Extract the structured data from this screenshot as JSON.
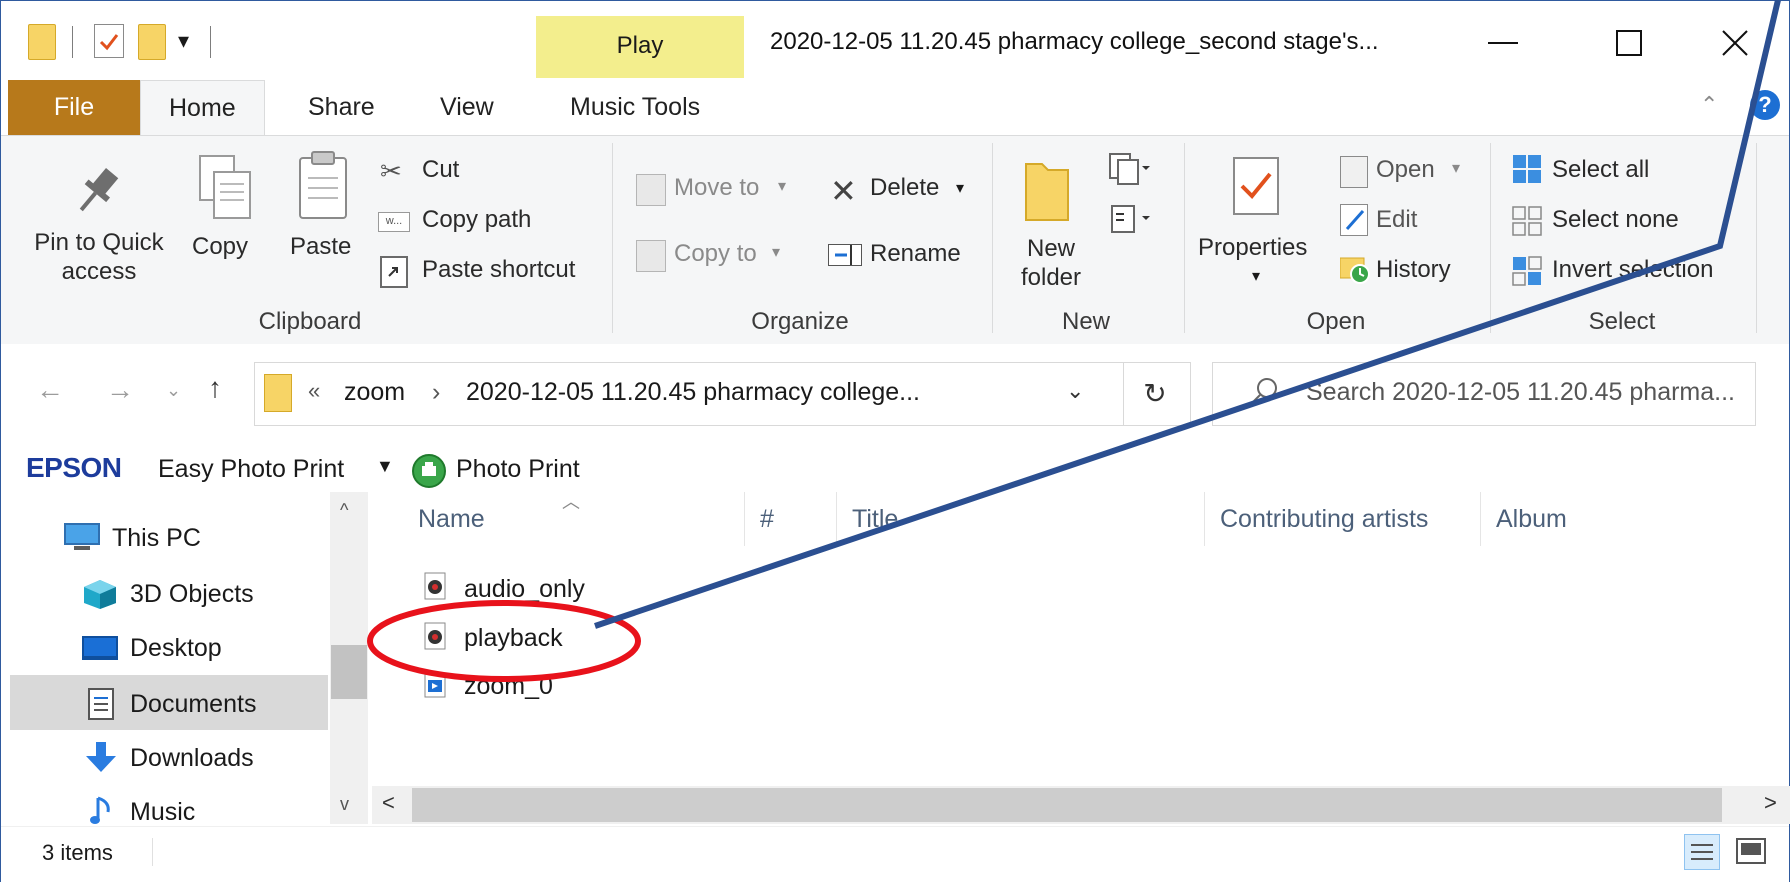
{
  "window": {
    "title": "2020-12-05 11.20.45 pharmacy college_second stage's...",
    "contextual_tab": "Play",
    "minimize_icon": "minimize-icon",
    "maximize_icon": "maximize-icon",
    "close_icon": "close-icon"
  },
  "ribbon_tabs": [
    "File",
    "Home",
    "Share",
    "View",
    "Music Tools"
  ],
  "ribbon": {
    "clipboard": {
      "pin_label_1": "Pin to Quick",
      "pin_label_2": "access",
      "copy": "Copy",
      "paste": "Paste",
      "cut": "Cut",
      "copy_path": "Copy path",
      "paste_shortcut": "Paste shortcut",
      "group": "Clipboard"
    },
    "organize": {
      "move_to": "Move to",
      "copy_to": "Copy to",
      "delete": "Delete",
      "rename": "Rename",
      "group": "Organize"
    },
    "new": {
      "new_folder_1": "New",
      "new_folder_2": "folder",
      "group": "New"
    },
    "open": {
      "properties": "Properties",
      "open": "Open",
      "edit": "Edit",
      "history": "History",
      "group": "Open"
    },
    "select": {
      "select_all": "Select all",
      "select_none": "Select none",
      "invert_selection": "Invert selection",
      "group": "Select"
    }
  },
  "address": {
    "overflow": "«",
    "crumb_1": "zoom",
    "separator": "›",
    "crumb_2": "2020-12-05 11.20.45 pharmacy college...",
    "search_placeholder": "Search 2020-12-05 11.20.45 pharma..."
  },
  "epson": {
    "brand": "EPSON",
    "easy_photo_print": "Easy Photo Print",
    "photo_print": "Photo Print"
  },
  "nav_pane": {
    "items": [
      {
        "label": "This PC",
        "icon": "this-pc-icon"
      },
      {
        "label": "3D Objects",
        "icon": "3d-objects-icon"
      },
      {
        "label": "Desktop",
        "icon": "desktop-icon"
      },
      {
        "label": "Documents",
        "icon": "documents-icon"
      },
      {
        "label": "Downloads",
        "icon": "downloads-icon"
      },
      {
        "label": "Music",
        "icon": "music-icon"
      }
    ],
    "selected": "Documents"
  },
  "columns": [
    "Name",
    "#",
    "Title",
    "Contributing artists",
    "Album"
  ],
  "files": [
    {
      "name": "audio_only",
      "icon": "audio-file-icon"
    },
    {
      "name": "playback",
      "icon": "audio-file-icon"
    },
    {
      "name": "zoom_0",
      "icon": "video-file-icon"
    }
  ],
  "status": {
    "item_count": "3 items"
  },
  "annotation": {
    "color": "#e8121b",
    "arrow_color": "#2b4f91",
    "highlighted_file": "playback"
  }
}
